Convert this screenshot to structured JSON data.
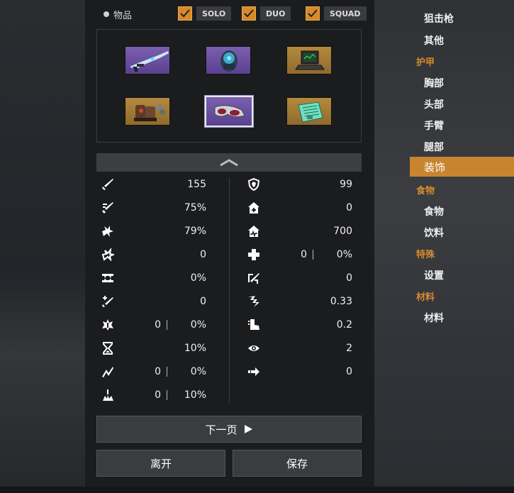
{
  "filters": {
    "items_label": "物品",
    "options": [
      {
        "label": "SOLO",
        "checked": true
      },
      {
        "label": "DUO",
        "checked": true
      },
      {
        "label": "SQUAD",
        "checked": true
      }
    ]
  },
  "grid": {
    "slots": [
      {
        "icon": "rifle-icon",
        "rarity": "purple",
        "selected": false
      },
      {
        "icon": "backpack-icon",
        "rarity": "purple",
        "selected": false
      },
      {
        "icon": "laptop-icon",
        "rarity": "gold",
        "selected": false
      },
      {
        "icon": "boots-icon",
        "rarity": "gold",
        "selected": false
      },
      {
        "icon": "goggles-icon",
        "rarity": "purple",
        "selected": true
      },
      {
        "icon": "document-icon",
        "rarity": "gold",
        "selected": false
      }
    ]
  },
  "stats_left": [
    {
      "icon": "sword-icon",
      "value": "155"
    },
    {
      "icon": "crit-rate-icon",
      "value": "75%"
    },
    {
      "icon": "crit-damage-icon",
      "value": "79%"
    },
    {
      "icon": "burst-icon",
      "value": "0"
    },
    {
      "icon": "fang-icon",
      "value": "0%"
    },
    {
      "icon": "sword-plus-icon",
      "value": "0"
    },
    {
      "icon": "armor-pierce-icon",
      "value1": "0",
      "value": "0%"
    },
    {
      "icon": "hourglass-icon",
      "value": "10%"
    },
    {
      "icon": "lightning-icon",
      "value1": "0",
      "value": "0%"
    },
    {
      "icon": "impact-icon",
      "value1": "0",
      "value": "10%"
    }
  ],
  "stats_right": [
    {
      "icon": "shield-icon",
      "value": "99"
    },
    {
      "icon": "house-plus-icon",
      "value": "0"
    },
    {
      "icon": "house-pulse-icon",
      "value": "700"
    },
    {
      "icon": "heal-cross-icon",
      "value1": "0",
      "value": "0%"
    },
    {
      "icon": "dodge-icon",
      "value": "0"
    },
    {
      "icon": "reload-icon",
      "value": "0.33"
    },
    {
      "icon": "boot-speed-icon",
      "value": "0.2"
    },
    {
      "icon": "eye-icon",
      "value": "2"
    },
    {
      "icon": "arrow-right-icon",
      "value": "0"
    }
  ],
  "buttons": {
    "next_page": "下一页",
    "leave": "离开",
    "save": "保存"
  },
  "sidebar": {
    "entries": [
      {
        "type": "item",
        "label": "狙击枪"
      },
      {
        "type": "item",
        "label": "其他"
      },
      {
        "type": "category",
        "label": "护甲"
      },
      {
        "type": "item",
        "label": "胸部"
      },
      {
        "type": "item",
        "label": "头部"
      },
      {
        "type": "item",
        "label": "手臂"
      },
      {
        "type": "item",
        "label": "腿部"
      },
      {
        "type": "selected",
        "label": "装饰"
      },
      {
        "type": "category",
        "label": "食物"
      },
      {
        "type": "item",
        "label": "食物"
      },
      {
        "type": "item",
        "label": "饮料"
      },
      {
        "type": "category",
        "label": "特殊"
      },
      {
        "type": "item",
        "label": "设置"
      },
      {
        "type": "category",
        "label": "材料"
      },
      {
        "type": "item",
        "label": "材料"
      }
    ]
  },
  "colors": {
    "accent": "#d68a2c",
    "purple_rarity": "#6a4fa0",
    "gold_rarity": "#a67c35"
  }
}
